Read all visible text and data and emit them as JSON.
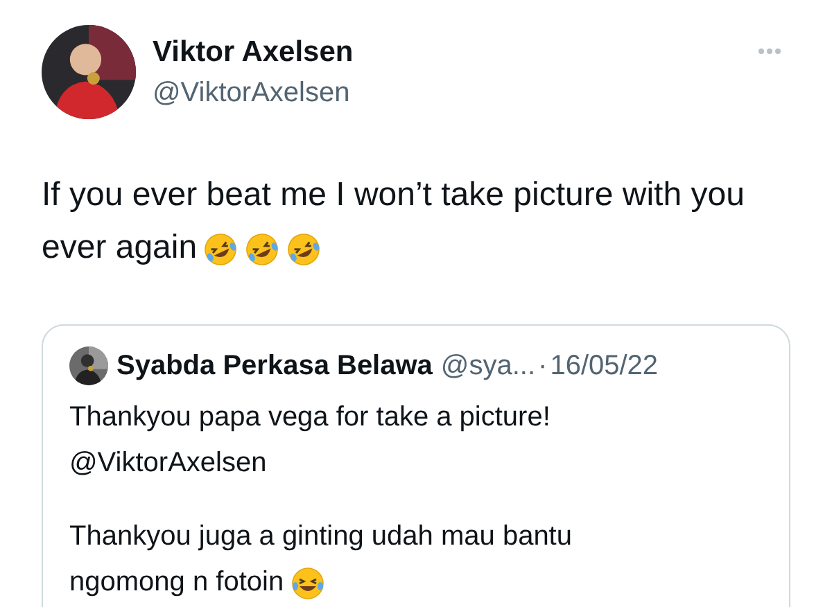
{
  "author": {
    "name": "Viktor Axelsen",
    "handle": "@ViktorAxelsen"
  },
  "more_menu": {
    "kind": "dots"
  },
  "tweet_text": "If you ever beat me I won’t take picture with you ever again",
  "tweet_emojis": [
    {
      "kind": "rofl"
    },
    {
      "kind": "rofl"
    },
    {
      "kind": "rofl"
    }
  ],
  "quoted_tweet": {
    "name": "Syabda Perkasa Belawa",
    "handle": "@sya...",
    "separator": "·",
    "date": "16/05/22",
    "paragraphs": [
      {
        "lines": [
          "Thankyou papa vega for take a picture!",
          "@ViktorAxelsen"
        ]
      },
      {
        "lines": [
          "Thankyou juga a ginting udah mau bantu ngomong n fotoin"
        ],
        "emojis": [
          {
            "kind": "tears-of-joy"
          }
        ]
      }
    ]
  }
}
